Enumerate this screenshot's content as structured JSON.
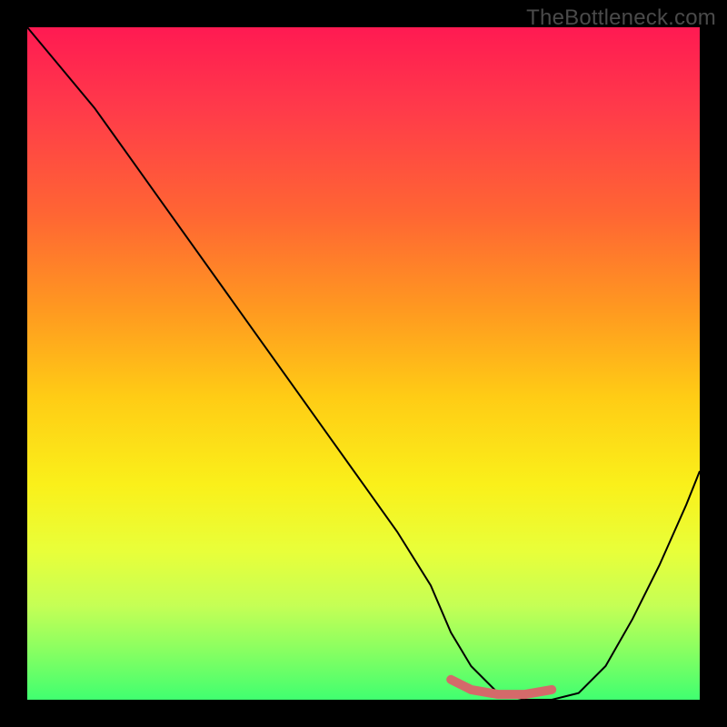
{
  "watermark": "TheBottleneck.com",
  "chart_data": {
    "type": "line",
    "title": "",
    "xlabel": "",
    "ylabel": "",
    "xlim": [
      0,
      100
    ],
    "ylim": [
      0,
      100
    ],
    "background_gradient": {
      "top": "#ff1a52",
      "mid": "#ffcc15",
      "bottom": "#40ff70"
    },
    "series": [
      {
        "name": "bottleneck-curve",
        "x": [
          0,
          5,
          10,
          15,
          20,
          25,
          30,
          35,
          40,
          45,
          50,
          55,
          60,
          63,
          66,
          70,
          74,
          78,
          82,
          86,
          90,
          94,
          98,
          100
        ],
        "y": [
          100,
          94,
          88,
          81,
          74,
          67,
          60,
          53,
          46,
          39,
          32,
          25,
          17,
          10,
          5,
          1,
          0,
          0,
          1,
          5,
          12,
          20,
          29,
          34
        ]
      }
    ],
    "highlight_segment": {
      "name": "optimal-range",
      "x": [
        63,
        66,
        70,
        74,
        78
      ],
      "y": [
        3,
        1.5,
        0.8,
        0.8,
        1.5
      ]
    },
    "annotations": []
  }
}
